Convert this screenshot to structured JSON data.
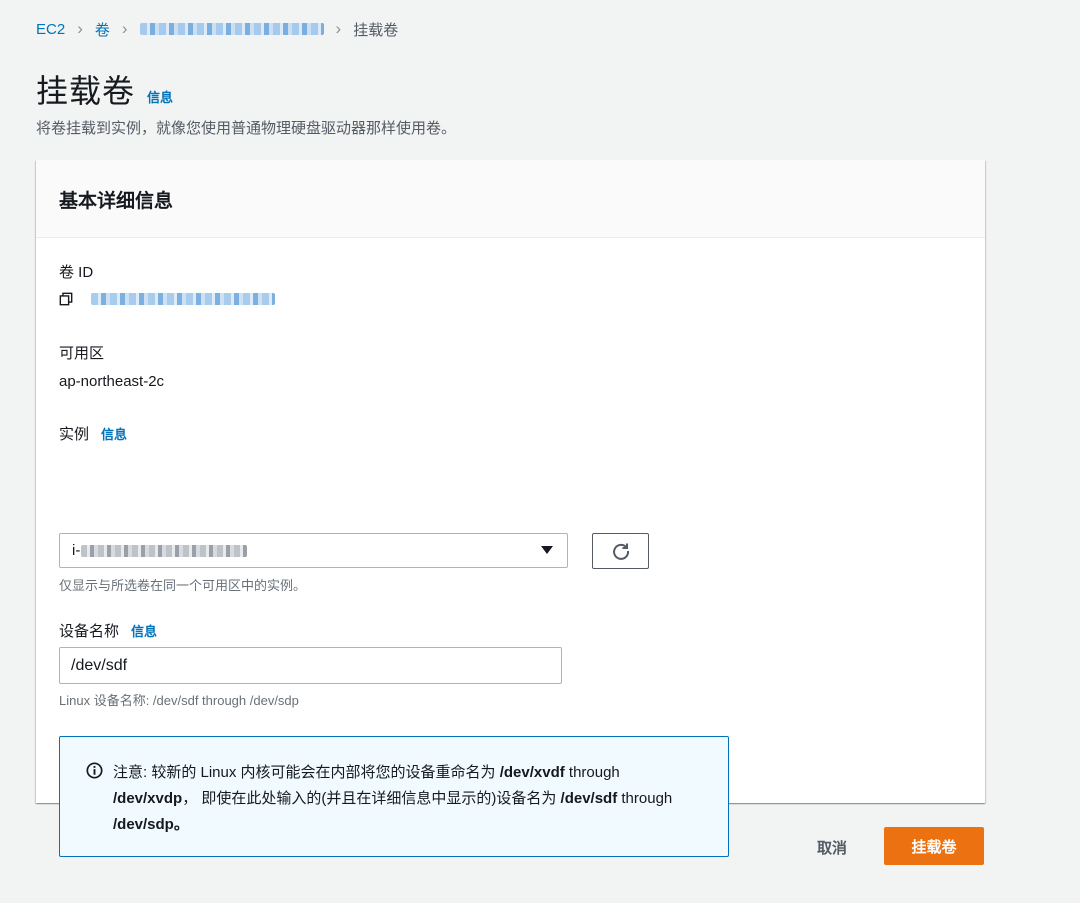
{
  "breadcrumb": {
    "items": [
      "EC2",
      "卷"
    ],
    "current": "挂载卷"
  },
  "header": {
    "title": "挂载卷",
    "info": "信息",
    "description": "将卷挂载到实例，就像您使用普通物理硬盘驱动器那样使用卷。"
  },
  "panel": {
    "title": "基本详细信息",
    "volume_id_label": "卷 ID",
    "az_label": "可用区",
    "az_value": "ap-northeast-2c",
    "instance_label": "实例",
    "instance_info": "信息",
    "instance_prefix": "i-",
    "instance_hint": "仅显示与所选卷在同一个可用区中的实例。",
    "device_label": "设备名称",
    "device_info": "信息",
    "device_value": "/dev/sdf",
    "device_hint": "Linux 设备名称: /dev/sdf through /dev/sdp",
    "alert": {
      "p1": "注意: 较新的 Linux 内核可能会在内部将您的设备重命名为 ",
      "b1": "/dev/xvdf",
      "p2": " through ",
      "b2": "/dev/xvdp",
      "p3": "， 即使在此处输入的(并且在详细信息中显示的)设备名为 ",
      "b3": "/dev/sdf",
      "p4": " through ",
      "b4": "/dev/sdp。"
    }
  },
  "footer": {
    "cancel": "取消",
    "submit": "挂载卷"
  },
  "colors": {
    "link": "#0073bb",
    "primary": "#ec7211",
    "alert_border": "#0073bb",
    "alert_bg": "#f1faff"
  },
  "icons": [
    "copy-icon",
    "refresh-icon",
    "info-circle-icon",
    "caret-down-icon"
  ]
}
